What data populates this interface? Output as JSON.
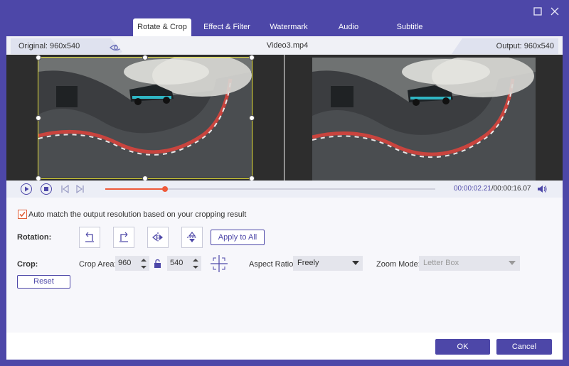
{
  "window": {
    "maximize_icon": "maximize-icon",
    "close_icon": "close-icon"
  },
  "tabs": [
    {
      "label": "Rotate & Crop",
      "active": true
    },
    {
      "label": "Effect & Filter"
    },
    {
      "label": "Watermark"
    },
    {
      "label": "Audio"
    },
    {
      "label": "Subtitle"
    }
  ],
  "infobar": {
    "original": "Original: 960x540",
    "filename": "Video3.mp4",
    "output": "Output: 960x540"
  },
  "player": {
    "time_current": "00:00:02.21",
    "time_separator": "/",
    "time_total": "00:00:16.07",
    "progress_fraction": 0.18,
    "accent": "#ef5a3a"
  },
  "settings": {
    "auto_match_label": "Auto match the output resolution based on your cropping result",
    "auto_match_checked": true,
    "rotation_label": "Rotation:",
    "apply_all_label": "Apply to All",
    "crop_label": "Crop:",
    "crop_area_label": "Crop Area:",
    "crop_width": "960",
    "crop_height": "540",
    "aspect_ratio_label": "Aspect Ratio:",
    "aspect_ratio_value": "Freely",
    "zoom_mode_label": "Zoom Mode:",
    "zoom_mode_value": "Letter Box",
    "reset_label": "Reset"
  },
  "footer": {
    "ok_label": "OK",
    "cancel_label": "Cancel"
  },
  "colors": {
    "brand": "#4d47a8",
    "crop_border": "#e8e23a"
  }
}
